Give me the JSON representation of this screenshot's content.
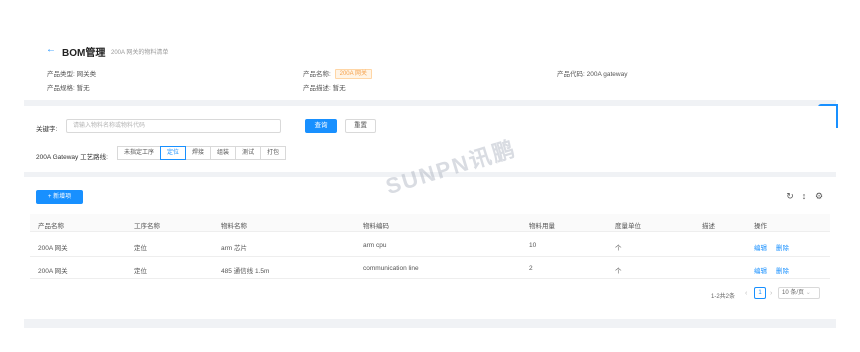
{
  "header": {
    "title": "BOM管理",
    "subtitle": "200A 网关的物料清单",
    "fields": {
      "product_type_label": "产品类型:",
      "product_type_value": "网关类",
      "product_name_label": "产品名称:",
      "product_name_value": "200A 网关",
      "product_code_label": "产品代码:",
      "product_code_value": "200A gateway",
      "product_spec_label": "产品规格:",
      "product_spec_value": "暂无",
      "product_desc_label": "产品描述:",
      "product_desc_value": "暂无"
    }
  },
  "search": {
    "keyword_label": "关键字:",
    "keyword_placeholder": "请输入物料名称或物料代码",
    "query_label": "查询",
    "reset_label": "重置",
    "route_label": "200A Gateway 工艺路线:",
    "route_steps": [
      "未指定工序",
      "定位",
      "焊接",
      "组装",
      "测试",
      "打包"
    ],
    "active_step": "定位"
  },
  "watermark": "SUNPN讯鹏",
  "table": {
    "add_label": "+ 新增项",
    "columns": [
      "产品名称",
      "工序名称",
      "物料名称",
      "物料编码",
      "物料用量",
      "度量单位",
      "描述",
      "操作"
    ],
    "rows": [
      {
        "product": "200A 网关",
        "process": "定位",
        "material": "arm 芯片",
        "code": "arm cpu",
        "qty": "10",
        "unit": "个",
        "desc": "",
        "edit": "编辑",
        "delete": "删除"
      },
      {
        "product": "200A 网关",
        "process": "定位",
        "material": "485 通信线 1.5m",
        "code": "communication line",
        "qty": "2",
        "unit": "个",
        "desc": "",
        "edit": "编辑",
        "delete": "删除"
      }
    ]
  },
  "pagination": {
    "total_text": "1-2共2条",
    "current_page": "1",
    "page_size": "10 条/页"
  },
  "colors": {
    "accent": "#1890ff",
    "tag_orange": "#f5a04a"
  },
  "icons": [
    "back-arrow-icon",
    "settings-gear-icon",
    "refresh-icon",
    "column-height-icon",
    "table-settings-icon"
  ]
}
